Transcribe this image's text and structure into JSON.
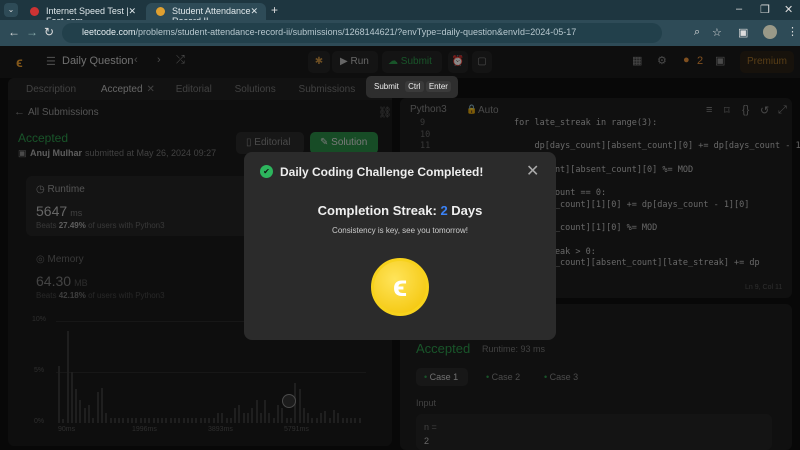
{
  "browser": {
    "tabs": [
      {
        "title": "Internet Speed Test | Fast.com"
      },
      {
        "title": "Student Attendance Record II"
      }
    ],
    "url_domain": "leetcode.com",
    "url_path": "/problems/student-attendance-record-ii/submissions/1268144621/?envType=daily-question&envId=2024-05-17"
  },
  "header": {
    "title": "Daily Question",
    "run": "Run",
    "submit": "Submit",
    "streak": "2",
    "premium": "Premium"
  },
  "tooltip": {
    "label": "Submit",
    "key1": "Ctrl",
    "key2": "Enter"
  },
  "tabs": [
    "Description",
    "Accepted",
    "Editorial",
    "Solutions",
    "Submissions"
  ],
  "left": {
    "back": "All Submissions",
    "status": "Accepted",
    "user": "Anuj Mulhar",
    "submitted": "submitted at May 26, 2024 09:27",
    "editorial": "Editorial",
    "solution": "Solution",
    "runtime": {
      "label": "Runtime",
      "value": "5647",
      "unit": "ms",
      "beats_pre": "Beats",
      "beats": "27.49%",
      "beats_post": "of users with Python3"
    },
    "memory": {
      "label": "Memory",
      "value": "64.30",
      "unit": "MB",
      "beats_pre": "Beats",
      "beats": "42.18%",
      "beats_post": "of users with Python3"
    }
  },
  "chart_data": {
    "type": "bar",
    "yticks": [
      "10%",
      "5%",
      "0%"
    ],
    "xticks": [
      "90ms",
      "1996ms",
      "3893ms",
      "5791ms"
    ],
    "ylim": [
      0,
      10
    ],
    "values": [
      5.6,
      0.4,
      9,
      5,
      3.3,
      2.3,
      1.5,
      1.8,
      0.5,
      3,
      3.4,
      1,
      0.5,
      0.5,
      0.5,
      0.5,
      0.5,
      0.5,
      0.5,
      0.5,
      0.5,
      0.5,
      0.5,
      0.5,
      0.5,
      0.5,
      0.5,
      0.5,
      0.5,
      0.5,
      0.5,
      0.5,
      0.5,
      0.5,
      0.5,
      0.5,
      0.5,
      1,
      1,
      0.5,
      0.5,
      1.5,
      1.8,
      1,
      1,
      1.5,
      2.3,
      1,
      2.3,
      1,
      0.5,
      1.8,
      1.5,
      0.5,
      0.5,
      3.9,
      3.3,
      1.5,
      1,
      0.5,
      0.5,
      1,
      1.2,
      0.5,
      1.3,
      1,
      0.5,
      0.5,
      0.5,
      0.5,
      0.5
    ]
  },
  "editor": {
    "language": "Python3",
    "mode": "Auto",
    "line_numbers": [
      "9",
      "10",
      "11"
    ],
    "lines": [
      "for late_streak in range(3):",
      "",
      "    dp[days_count][absent_count][0] += dp[days_count - 1]",
      "  k]",
      "  ys_count][absent_count][0] %= MOD",
      "",
      "  sent_count == 0:",
      "  p[days_count][1][0] += dp[days_count - 1][0]",
      "",
      "  p[days_count][1][0] %= MOD",
      "",
      "  te_streak > 0:",
      "  p[days_count][absent_count][late_streak] += dp"
    ],
    "cursor": "Ln 9, Col 11"
  },
  "result": {
    "status": "Accepted",
    "runtime": "Runtime: 93 ms",
    "cases": [
      "Case 1",
      "Case 2",
      "Case 3"
    ],
    "input_label": "Input",
    "input_var": "n =",
    "input_value": "2"
  },
  "modal": {
    "title": "Daily Coding Challenge Completed!",
    "streak_label": "Completion Streak:",
    "streak_value": "2",
    "streak_unit": "Days",
    "message": "Consistency is key, see you tomorrow!"
  }
}
